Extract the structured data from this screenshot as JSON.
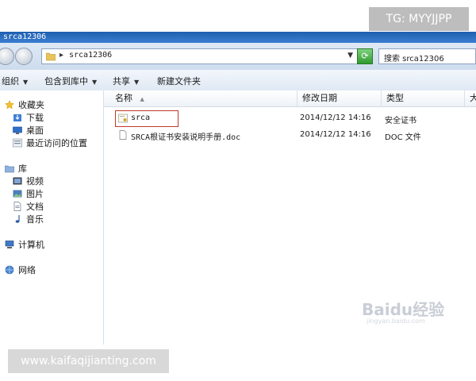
{
  "window": {
    "title": "srca12306"
  },
  "address_bar": {
    "separator": "▸",
    "path": "srca12306",
    "dropdown": "▼",
    "refresh": "⟳"
  },
  "search": {
    "text": "搜索 srca12306"
  },
  "toolbar": {
    "organize": "组织",
    "include_library": "包含到库中",
    "share": "共享",
    "new_folder": "新建文件夹",
    "arrow": "▼"
  },
  "sidebar": {
    "favorites": {
      "label": "收藏夹",
      "items": [
        "下载",
        "桌面",
        "最近访问的位置"
      ]
    },
    "libraries": {
      "label": "库",
      "items": [
        "视频",
        "图片",
        "文档",
        "音乐"
      ]
    },
    "computer": "计算机",
    "network": "网络"
  },
  "columns": {
    "name": "名称",
    "sort_indicator": "▲",
    "modified": "修改日期",
    "type": "类型",
    "size": "大"
  },
  "files": [
    {
      "name": "srca",
      "modified": "2014/12/12 14:16",
      "type": "安全证书"
    },
    {
      "name": "SRCA根证书安装说明手册.doc",
      "modified": "2014/12/12 14:16",
      "type": "DOC 文件"
    }
  ],
  "overlays": {
    "tg": "TG: MYYJJPP",
    "site": "www.kaifaqijianting.com",
    "watermark": "Baidu经验",
    "watermark_sub": "jingyan.baidu.com"
  },
  "colors": {
    "title_bar": "#2b6cc0",
    "selection_box": "#c0392b",
    "refresh": "#2f9a2f"
  }
}
